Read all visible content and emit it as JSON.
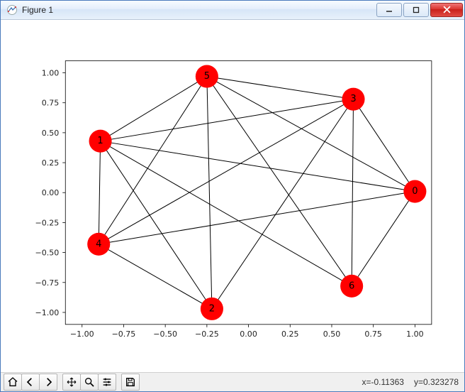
{
  "window": {
    "title": "Figure 1"
  },
  "toolbar": {
    "home": "Home",
    "back": "Back",
    "forward": "Forward",
    "pan": "Pan",
    "zoom": "Zoom",
    "config": "Configure",
    "save": "Save"
  },
  "status": {
    "x_label": "x=-0.11363",
    "y_label": "y=0.323278"
  },
  "chart_data": {
    "type": "network",
    "xlim": [
      -1.1,
      1.1
    ],
    "ylim": [
      -1.1,
      1.1
    ],
    "xticks": [
      -1.0,
      -0.75,
      -0.5,
      -0.25,
      0.0,
      0.25,
      0.5,
      0.75,
      1.0
    ],
    "yticks": [
      -1.0,
      -0.75,
      -0.5,
      -0.25,
      0.0,
      0.25,
      0.5,
      0.75,
      1.0
    ],
    "xtick_labels": [
      "−1.00",
      "−0.75",
      "−0.50",
      "−0.25",
      "0.00",
      "0.25",
      "0.50",
      "0.75",
      "1.00"
    ],
    "ytick_labels": [
      "−1.00",
      "−0.75",
      "−0.50",
      "−0.25",
      "0.00",
      "0.25",
      "0.50",
      "0.75",
      "1.00"
    ],
    "nodes": [
      {
        "id": "0",
        "x": 1.0,
        "y": 0.01
      },
      {
        "id": "1",
        "x": -0.89,
        "y": 0.43
      },
      {
        "id": "2",
        "x": -0.22,
        "y": -0.97
      },
      {
        "id": "3",
        "x": 0.63,
        "y": 0.78
      },
      {
        "id": "4",
        "x": -0.9,
        "y": -0.43
      },
      {
        "id": "5",
        "x": -0.25,
        "y": 0.97
      },
      {
        "id": "6",
        "x": 0.62,
        "y": -0.78
      }
    ],
    "edges": [
      [
        "0",
        "1"
      ],
      [
        "0",
        "3"
      ],
      [
        "0",
        "4"
      ],
      [
        "0",
        "5"
      ],
      [
        "0",
        "6"
      ],
      [
        "1",
        "2"
      ],
      [
        "1",
        "3"
      ],
      [
        "1",
        "4"
      ],
      [
        "1",
        "5"
      ],
      [
        "1",
        "6"
      ],
      [
        "2",
        "3"
      ],
      [
        "2",
        "4"
      ],
      [
        "2",
        "5"
      ],
      [
        "3",
        "4"
      ],
      [
        "3",
        "5"
      ],
      [
        "3",
        "6"
      ],
      [
        "4",
        "5"
      ],
      [
        "5",
        "6"
      ]
    ],
    "node_color": "#ff0000",
    "node_size": 16
  }
}
